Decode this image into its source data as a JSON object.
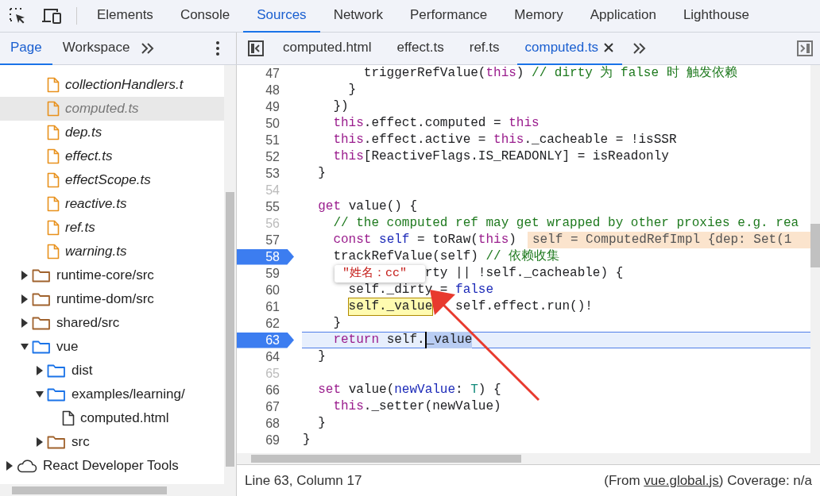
{
  "main_tabs": [
    {
      "label": "Elements",
      "selected": false
    },
    {
      "label": "Console",
      "selected": false
    },
    {
      "label": "Sources",
      "selected": true
    },
    {
      "label": "Network",
      "selected": false
    },
    {
      "label": "Performance",
      "selected": false
    },
    {
      "label": "Memory",
      "selected": false
    },
    {
      "label": "Application",
      "selected": false
    },
    {
      "label": "Lighthouse",
      "selected": false
    }
  ],
  "navigator_tabs": [
    {
      "label": "Page",
      "selected": true
    },
    {
      "label": "Workspace",
      "selected": false
    }
  ],
  "tree": [
    {
      "children": [
        {
          "children": [
            {
              "label": "collectionHandlers.t",
              "kind": "mapped-file",
              "selected": false
            },
            {
              "label": "computed.ts",
              "kind": "mapped-file",
              "selected": true
            },
            {
              "label": "dep.ts",
              "kind": "mapped-file",
              "selected": false
            },
            {
              "label": "effect.ts",
              "kind": "mapped-file",
              "selected": false
            },
            {
              "label": "effectScope.ts",
              "kind": "mapped-file",
              "selected": false
            },
            {
              "label": "reactive.ts",
              "kind": "mapped-file",
              "selected": false
            },
            {
              "label": "ref.ts",
              "kind": "mapped-file",
              "selected": false
            },
            {
              "label": "warning.ts",
              "kind": "mapped-file",
              "selected": false
            }
          ]
        },
        {
          "label": "runtime-core/src",
          "kind": "folder",
          "color": "#a0622d",
          "expanded": false,
          "selected": false
        },
        {
          "label": "runtime-dom/src",
          "kind": "folder",
          "color": "#a0622d",
          "expanded": false,
          "selected": false
        },
        {
          "label": "shared/src",
          "kind": "folder",
          "color": "#a0622d",
          "expanded": false,
          "selected": false
        },
        {
          "label": "vue",
          "kind": "folder",
          "color": "#1a73e8",
          "expanded": true,
          "selected": false,
          "children": [
            {
              "label": "dist",
              "kind": "folder",
              "color": "#1a73e8",
              "expanded": false,
              "selected": false
            },
            {
              "label": "examples/learning/",
              "kind": "folder",
              "color": "#1a73e8",
              "expanded": true,
              "selected": false,
              "children": [
                {
                  "label": "computed.html",
                  "kind": "file",
                  "selected": false
                }
              ]
            },
            {
              "label": "src",
              "kind": "folder",
              "color": "#a0622d",
              "expanded": false,
              "selected": false
            }
          ]
        }
      ]
    },
    {
      "label": "React Developer Tools",
      "kind": "extension",
      "expanded": false,
      "selected": false
    }
  ],
  "editor_tabs": [
    {
      "label": "computed.html",
      "selected": false
    },
    {
      "label": "effect.ts",
      "selected": false
    },
    {
      "label": "ref.ts",
      "selected": false
    },
    {
      "label": "computed.ts",
      "selected": true
    }
  ],
  "code_lines": [
    {
      "number": "47",
      "breakable": true,
      "breakpoint": false,
      "current": false,
      "tokens": [
        {
          "t": "        triggerRefValue(",
          "kind": "plain"
        },
        {
          "t": "this",
          "kind": "keyword"
        },
        {
          "t": ") ",
          "kind": "plain"
        },
        {
          "t": "// dirty 为 false 时 触发依赖",
          "kind": "comment"
        }
      ]
    },
    {
      "number": "48",
      "breakable": true,
      "breakpoint": false,
      "current": false,
      "tokens": [
        {
          "t": "      }",
          "kind": "plain"
        }
      ]
    },
    {
      "number": "49",
      "breakable": true,
      "breakpoint": false,
      "current": false,
      "tokens": [
        {
          "t": "    })",
          "kind": "plain"
        }
      ]
    },
    {
      "number": "50",
      "breakable": true,
      "breakpoint": false,
      "current": false,
      "tokens": [
        {
          "t": "    this",
          "kind": "keyword"
        },
        {
          "t": ".effect.computed = ",
          "kind": "plain"
        },
        {
          "t": "this",
          "kind": "keyword"
        }
      ]
    },
    {
      "number": "51",
      "breakable": true,
      "breakpoint": false,
      "current": false,
      "tokens": [
        {
          "t": "    this",
          "kind": "keyword"
        },
        {
          "t": ".effect.active = ",
          "kind": "plain"
        },
        {
          "t": "this",
          "kind": "keyword"
        },
        {
          "t": "._cacheable = !isSSR",
          "kind": "plain"
        }
      ]
    },
    {
      "number": "52",
      "breakable": true,
      "breakpoint": false,
      "current": false,
      "tokens": [
        {
          "t": "    this",
          "kind": "keyword"
        },
        {
          "t": "[ReactiveFlags.IS_READONLY] = isReadonly",
          "kind": "plain"
        }
      ]
    },
    {
      "number": "53",
      "breakable": true,
      "breakpoint": false,
      "current": false,
      "tokens": [
        {
          "t": "  }",
          "kind": "plain"
        }
      ]
    },
    {
      "number": "54",
      "breakable": false,
      "breakpoint": false,
      "current": false
    },
    {
      "number": "55",
      "breakable": true,
      "breakpoint": false,
      "current": false,
      "tokens": [
        {
          "t": "  get",
          "kind": "keyword"
        },
        {
          "t": " value() {",
          "kind": "plain"
        }
      ]
    },
    {
      "number": "56",
      "breakable": false,
      "breakpoint": false,
      "current": false,
      "tokens": [
        {
          "t": "    // the computed ref may get wrapped by other proxies e.g. rea",
          "kind": "comment"
        }
      ]
    },
    {
      "number": "57",
      "breakable": true,
      "breakpoint": false,
      "current": false,
      "tokens": [
        {
          "t": "    const",
          "kind": "keyword"
        },
        {
          "t": " self",
          "kind": "variable"
        },
        {
          "t": " = toRaw(",
          "kind": "plain"
        },
        {
          "t": "this",
          "kind": "keyword"
        },
        {
          "t": ")",
          "kind": "plain"
        }
      ],
      "inline_value": "self = ComputedRefImpl {dep: Set(1"
    },
    {
      "number": "58",
      "breakable": true,
      "breakpoint": true,
      "current": false,
      "tokens": [
        {
          "t": "    trackRefValue(self) ",
          "kind": "plain"
        },
        {
          "t": "// 依赖收集",
          "kind": "comment"
        }
      ]
    },
    {
      "number": "59",
      "breakable": true,
      "breakpoint": false,
      "current": false,
      "tokens": [
        {
          "t": "                rty || !self._cacheable) {",
          "kind": "plain"
        }
      ]
    },
    {
      "number": "60",
      "breakable": true,
      "breakpoint": false,
      "current": false,
      "tokens": [
        {
          "t": "      self._dirty = ",
          "kind": "plain"
        },
        {
          "t": "false",
          "kind": "literal"
        }
      ]
    },
    {
      "number": "61",
      "breakable": true,
      "breakpoint": false,
      "current": false,
      "tokens": [
        {
          "t": "      self._value",
          "kind": "hovered"
        },
        {
          "t": "   self.effect.run()!",
          "kind": "plain"
        }
      ]
    },
    {
      "number": "62",
      "breakable": true,
      "breakpoint": false,
      "current": false,
      "tokens": [
        {
          "t": "    }",
          "kind": "plain"
        }
      ]
    },
    {
      "number": "63",
      "breakable": true,
      "breakpoint": true,
      "current": true,
      "tokens": [
        {
          "t": "    return",
          "kind": "keyword"
        },
        {
          "t": " self.",
          "kind": "plain"
        },
        {
          "t": "_value",
          "kind": "selection"
        }
      ]
    },
    {
      "number": "64",
      "breakable": true,
      "breakpoint": false,
      "current": false,
      "tokens": [
        {
          "t": "  }",
          "kind": "plain"
        }
      ]
    },
    {
      "number": "65",
      "breakable": false,
      "breakpoint": false,
      "current": false
    },
    {
      "number": "66",
      "breakable": true,
      "breakpoint": false,
      "current": false,
      "tokens": [
        {
          "t": "  set",
          "kind": "keyword"
        },
        {
          "t": " value(",
          "kind": "plain"
        },
        {
          "t": "newValue",
          "kind": "variable"
        },
        {
          "t": ": ",
          "kind": "plain"
        },
        {
          "t": "T",
          "kind": "type"
        },
        {
          "t": ") {",
          "kind": "plain"
        }
      ]
    },
    {
      "number": "67",
      "breakable": true,
      "breakpoint": false,
      "current": false,
      "tokens": [
        {
          "t": "    this",
          "kind": "keyword"
        },
        {
          "t": "._setter(newValue)",
          "kind": "plain"
        }
      ]
    },
    {
      "number": "68",
      "breakable": true,
      "breakpoint": false,
      "current": false,
      "tokens": [
        {
          "t": "  }",
          "kind": "plain"
        }
      ]
    },
    {
      "number": "69",
      "breakable": true,
      "breakpoint": false,
      "current": false,
      "tokens": [
        {
          "t": "}",
          "kind": "plain"
        }
      ]
    }
  ],
  "popover": {
    "value": "\"姓名：cc\""
  },
  "status_bar": {
    "position": "Line 63, Column 17",
    "source_prefix": "(From ",
    "source_link": "vue.global.js",
    "source_suffix": ") Coverage: n/a"
  }
}
